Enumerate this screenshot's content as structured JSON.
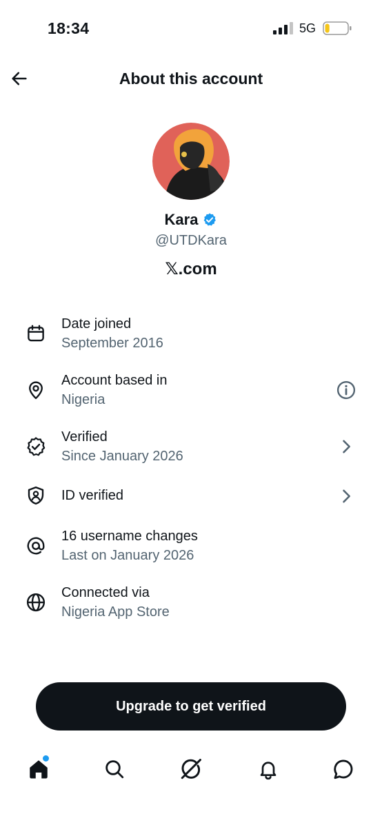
{
  "status_bar": {
    "time": "18:34",
    "network": "5G",
    "battery_level": 0.2,
    "battery_color": "#f5c518"
  },
  "header": {
    "title": "About this account"
  },
  "profile": {
    "name": "Kara",
    "handle": "@UTDKara",
    "platform": "𝕏.com",
    "verified_badge_color": "#1d9bf0"
  },
  "info_items": [
    {
      "icon": "calendar-icon",
      "title": "Date joined",
      "subtitle": "September 2016"
    },
    {
      "icon": "location-pin-icon",
      "title": "Account based in",
      "subtitle": "Nigeria",
      "action": "info-icon"
    },
    {
      "icon": "verified-badge-icon",
      "title": "Verified",
      "subtitle": "Since January 2026",
      "action": "chevron-right-icon"
    },
    {
      "icon": "shield-person-icon",
      "title": "ID verified",
      "action": "chevron-right-icon"
    },
    {
      "icon": "at-sign-icon",
      "title": "16 username changes",
      "subtitle": "Last on January 2026"
    },
    {
      "icon": "globe-icon",
      "title": "Connected via",
      "subtitle": "Nigeria App Store"
    }
  ],
  "cta": {
    "label": "Upgrade to get verified"
  },
  "tab_bar": {
    "tabs": [
      "home-icon",
      "search-icon",
      "grok-icon",
      "notifications-bell-icon",
      "messages-icon"
    ],
    "notification_dot_color": "#1d9bf0"
  },
  "colors": {
    "primary_text": "#0f1419",
    "secondary_text": "#536471",
    "accent": "#1d9bf0",
    "button_bg": "#0f1419"
  }
}
